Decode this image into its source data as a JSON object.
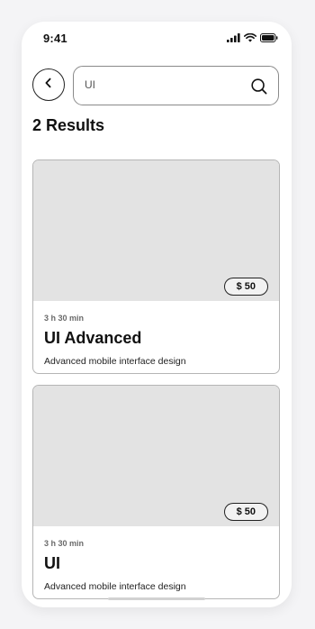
{
  "status_bar": {
    "time": "9:41",
    "icons": [
      "signal-icon",
      "wifi-icon",
      "battery-icon"
    ]
  },
  "search": {
    "value": "UI",
    "icon": "search-icon"
  },
  "back": {
    "icon": "chevron-left-icon"
  },
  "results": {
    "title": "2 Results"
  },
  "courses": [
    {
      "price": "$ 50",
      "duration": "3 h 30 min",
      "title": "UI Advanced",
      "description": "Advanced mobile interface design"
    },
    {
      "price": "$ 50",
      "duration": "3 h 30 min",
      "title": "UI",
      "description": "Advanced mobile interface design"
    }
  ],
  "colors": {
    "image_placeholder": "#e3e3e3",
    "border": "#b5b5b5",
    "text": "#111111"
  }
}
